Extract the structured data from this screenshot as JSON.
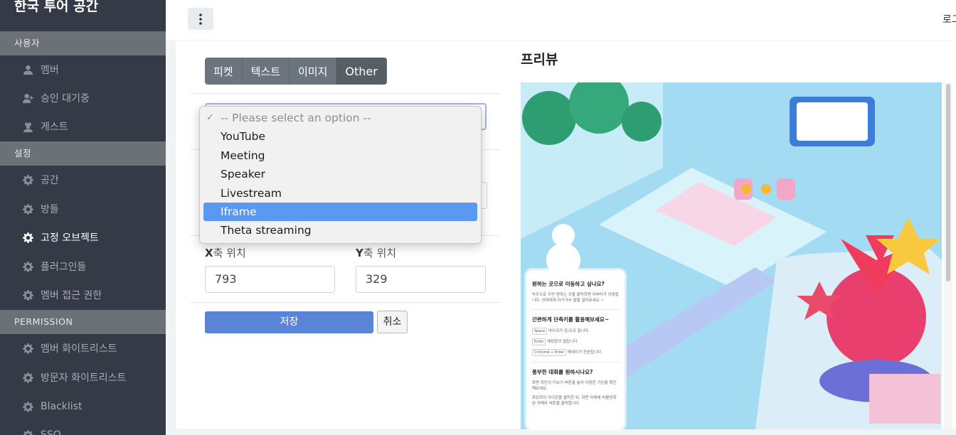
{
  "sidebar": {
    "brand": "한국 투어 공간",
    "sections": [
      {
        "title": "사용자",
        "items": [
          {
            "label": "멤버",
            "icon": "user-icon"
          },
          {
            "label": "승인 대기중",
            "icon": "user-plus-icon"
          },
          {
            "label": "게스트",
            "icon": "user-secret-icon"
          }
        ]
      },
      {
        "title": "설정",
        "items": [
          {
            "label": "공간",
            "icon": "gear-icon"
          },
          {
            "label": "방들",
            "icon": "gear-icon"
          },
          {
            "label": "고정 오브젝트",
            "icon": "gear-icon",
            "active": true
          },
          {
            "label": "플러그인들",
            "icon": "gear-icon"
          },
          {
            "label": "멤버 접근 권한",
            "icon": "gear-icon"
          }
        ]
      },
      {
        "title": "PERMISSION",
        "items": [
          {
            "label": "멤버 화이트리스트",
            "icon": "gear-icon"
          },
          {
            "label": "방문자 화이트리스트",
            "icon": "gear-icon"
          },
          {
            "label": "Blacklist",
            "icon": "gear-icon"
          },
          {
            "label": "SSO",
            "icon": "gear-icon"
          }
        ]
      }
    ]
  },
  "topbar": {
    "right_text": "로그"
  },
  "tabs": [
    {
      "label": "피켓"
    },
    {
      "label": "텍스트"
    },
    {
      "label": "이미지"
    },
    {
      "label": "Other",
      "active": true
    }
  ],
  "type_select": {
    "options": [
      {
        "label": "-- Please select an option --",
        "placeholder": true,
        "checked": true
      },
      {
        "label": "YouTube"
      },
      {
        "label": "Meeting"
      },
      {
        "label": "Speaker"
      },
      {
        "label": "Livestream"
      },
      {
        "label": "Iframe",
        "highlighted": true
      },
      {
        "label": "Theta streaming"
      }
    ]
  },
  "position": {
    "x_label_axis": "X",
    "x_label_rest": "축 위치",
    "x_value": "793",
    "y_label_axis": "Y",
    "y_label_rest": "축 위치",
    "y_value": "329"
  },
  "actions": {
    "save": "저장",
    "cancel": "취소"
  },
  "preview": {
    "title": "프리뷰",
    "card": {
      "h1": "원하는 곳으로 이동하고 싶나요?",
      "p1": "마우스로 두번 원하는 곳을 클릭하면 아바타가 이동합니다. 상대에게 다가가서 말을 걸어보세요 ~",
      "h2": "간편하게 단축키를 활용해보세요~",
      "s1_key": "Space",
      "s1_text": "마이크가 온/오프 됩니다.",
      "s2_key": "Enter",
      "s2_text": "채팅창이 열립니다.",
      "s3_key": "Ctrl/cmd + Enter",
      "s3_text": "메세지가 전송됩니다.",
      "h3": "풍부한 대화를 원하시나요?",
      "p3": "화면 하단의 더보기 버튼을 눌러 다양한 기능을 확인해보세요.",
      "p4": "화상회의 아이콘을 클릭한 뒤, 화면 아래에 비활성화된 카메라 버튼을 클릭합니다."
    }
  }
}
